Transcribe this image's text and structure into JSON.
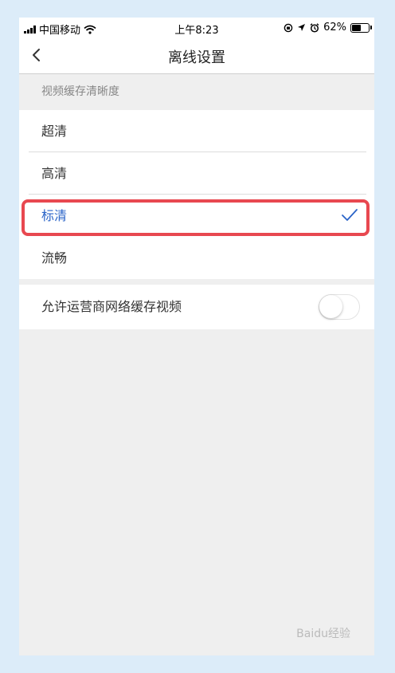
{
  "status_bar": {
    "carrier": "中国移动",
    "time": "上午8:23",
    "battery_percent": "62%",
    "battery_level": 0.62
  },
  "nav": {
    "title": "离线设置"
  },
  "section": {
    "header": "视频缓存清晰度"
  },
  "options": [
    {
      "label": "超清",
      "selected": false
    },
    {
      "label": "高清",
      "selected": false
    },
    {
      "label": "标清",
      "selected": true
    },
    {
      "label": "流畅",
      "selected": false
    }
  ],
  "toggle": {
    "label": "允许运营商网络缓存视频",
    "on": false
  },
  "colors": {
    "accent": "#2b64c8",
    "highlight": "#e84850"
  },
  "watermark": "Baidu经验"
}
